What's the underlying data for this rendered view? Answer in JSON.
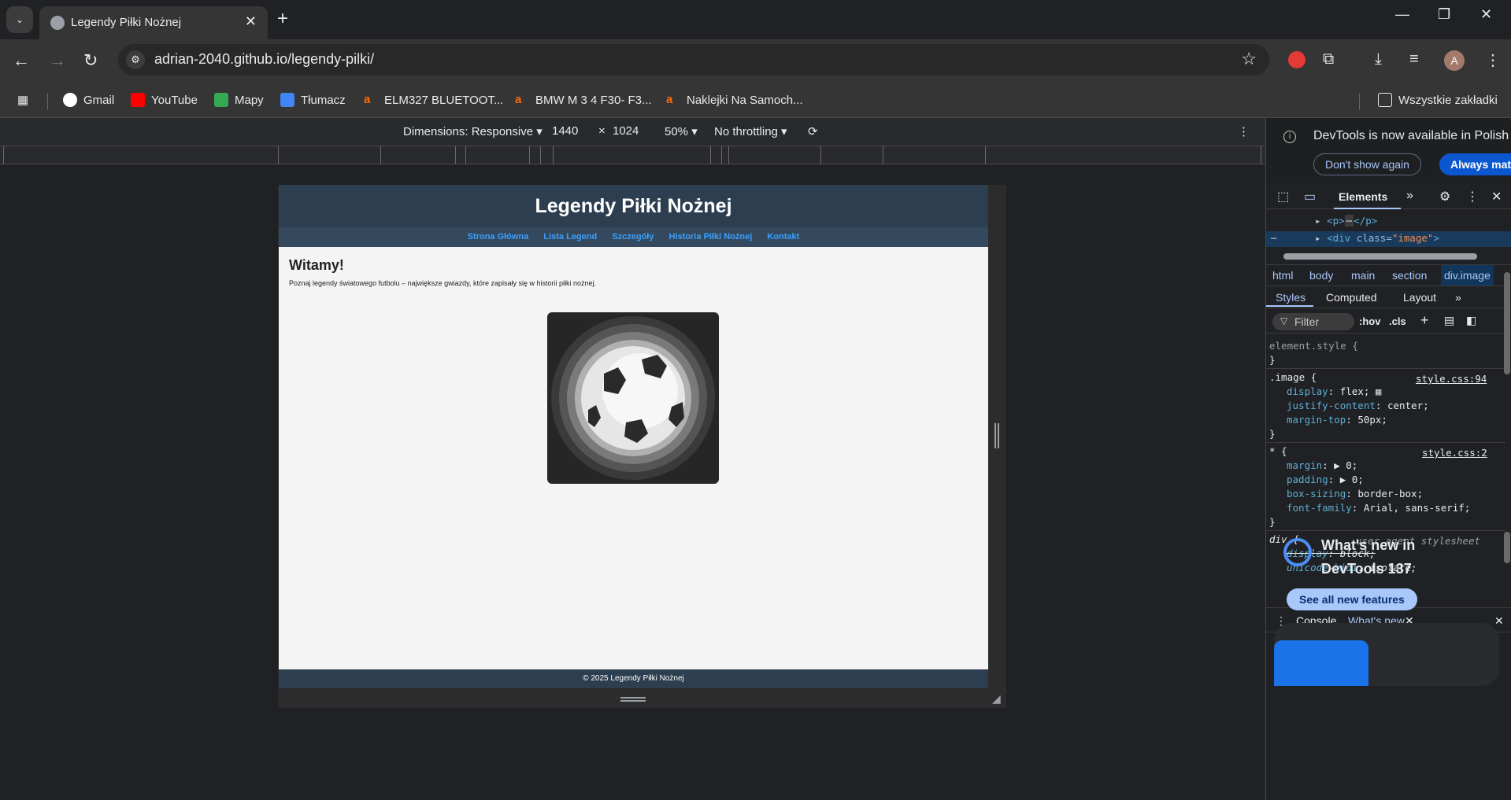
{
  "browser": {
    "tab_title": "Legendy Piłki Nożnej",
    "url": "adrian-2040.github.io/legendy-pilki/",
    "avatar_letter": "A",
    "bookmarks": [
      {
        "label": "Gmail",
        "color": "#ea4335"
      },
      {
        "label": "YouTube",
        "color": "#ff0000"
      },
      {
        "label": "Mapy",
        "color": "#34a853"
      },
      {
        "label": "Tłumacz",
        "color": "#4285f4"
      },
      {
        "label": "ELM327 BLUETOOT...",
        "color": "#ff6a00"
      },
      {
        "label": "BMW M 3 4 F30- F3...",
        "color": "#ff6a00"
      },
      {
        "label": "Naklejki Na Samoch...",
        "color": "#ff6a00"
      }
    ],
    "all_bookmarks": "Wszystkie zakładki"
  },
  "device_toolbar": {
    "dimensions_label": "Dimensions: Responsive",
    "width": "1440",
    "times": "×",
    "height": "1024",
    "zoom": "50%",
    "throttling": "No throttling"
  },
  "site": {
    "title": "Legendy Piłki Nożnej",
    "nav": [
      "Strona Główna",
      "Lista Legend",
      "Szczegóły",
      "Historia Piłki Nożnej",
      "Kontakt"
    ],
    "welcome": "Witamy!",
    "intro": "Poznaj legendy światowego futbolu – największe gwiazdy, które zapisały się w historii piłki nożnej.",
    "footer": "© 2025 Legendy Piłki Nożnej"
  },
  "devtools": {
    "info_message": "DevTools is now available in Polish",
    "dont_show": "Don't show again",
    "always_match": "Always mat",
    "tab_elements": "Elements",
    "dom_lines": {
      "p_open": "<p>",
      "p_close": "</p>",
      "div_tag": "<div",
      "div_attr": "class=",
      "div_val": "\"image\"",
      "div_end": ">"
    },
    "breadcrumbs": [
      "html",
      "body",
      "main",
      "section",
      "div.image"
    ],
    "subtabs": [
      "Styles",
      "Computed",
      "Layout"
    ],
    "filter_placeholder": "Filter",
    "hov": ":hov",
    "cls": ".cls",
    "styles": {
      "element_style": "element.style {",
      "close": "}",
      "image_selector": ".image {",
      "image_source": "style.css:94",
      "image_props": [
        {
          "name": "display",
          "value": "flex;"
        },
        {
          "name": "justify-content",
          "value": "center;"
        },
        {
          "name": "margin-top",
          "value": "50px;"
        }
      ],
      "star_selector": "* {",
      "star_source": "style.css:2",
      "star_props": [
        {
          "name": "margin",
          "value": "▶ 0;"
        },
        {
          "name": "padding",
          "value": "▶ 0;"
        },
        {
          "name": "box-sizing",
          "value": "border-box;"
        },
        {
          "name": "font-family",
          "value": "Arial, sans-serif;"
        }
      ],
      "div_selector": "div {",
      "div_source": "user agent stylesheet",
      "div_props": [
        {
          "name": "display",
          "value": "block;"
        },
        {
          "name": "unicode-bidi",
          "value": "isolate;"
        }
      ]
    },
    "drawer_tabs": [
      "Console",
      "What's new"
    ],
    "whats_new_title_1": "What's new in",
    "whats_new_title_2": "DevTools 137",
    "see_all": "See all new features"
  }
}
